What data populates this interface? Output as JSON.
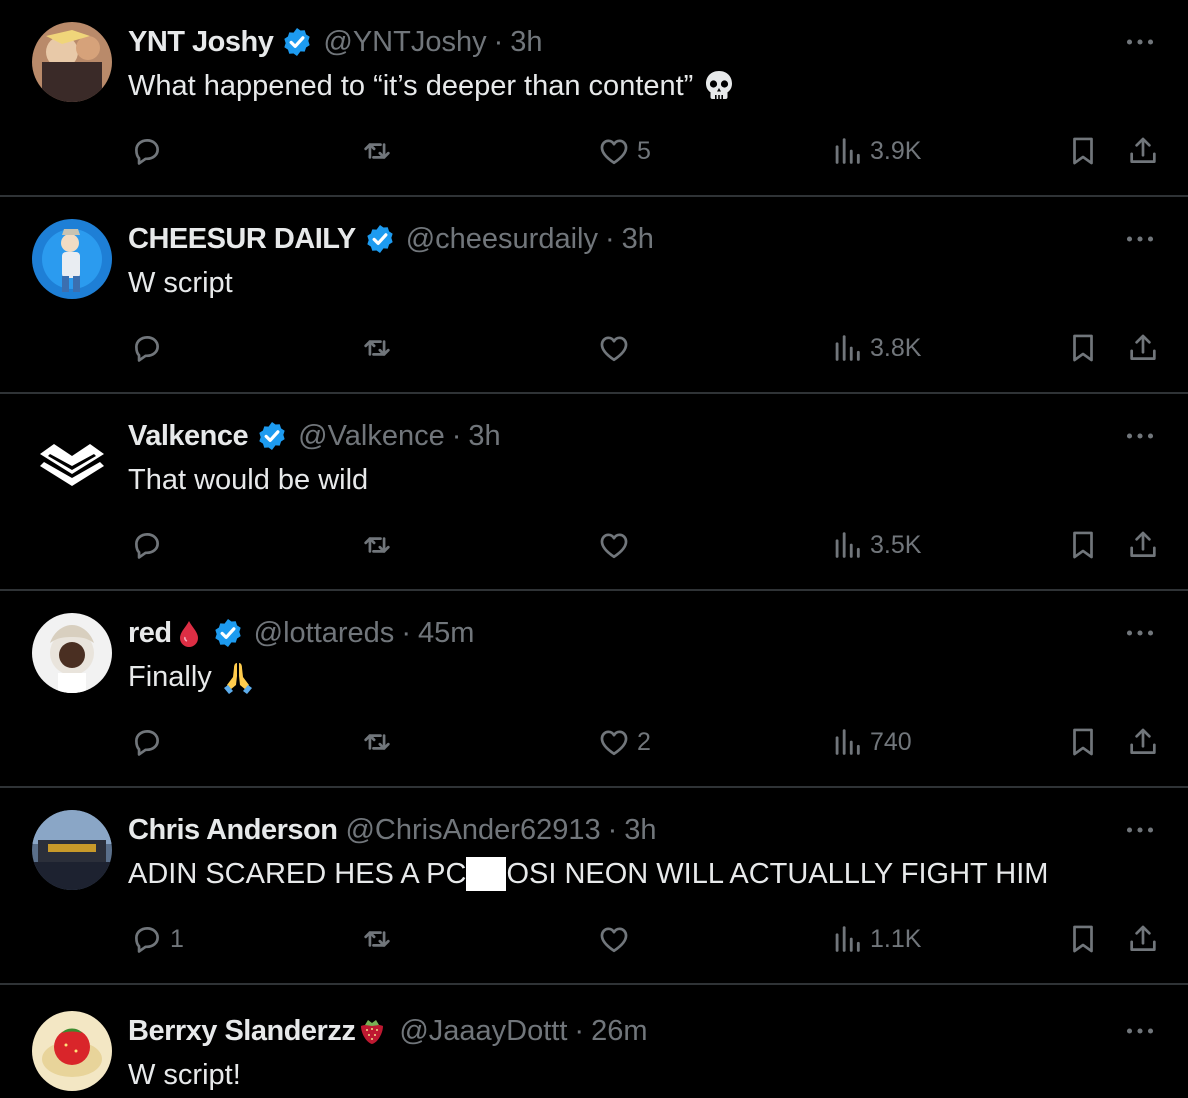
{
  "colors": {
    "background": "#000000",
    "text_primary": "#e7e9ea",
    "text_secondary": "#71767b",
    "divider": "#2f3336",
    "verified_badge": "#1d9bf0"
  },
  "icons": {
    "reply": "reply-icon",
    "retweet": "retweet-icon",
    "like": "heart-icon",
    "views": "views-icon",
    "bookmark": "bookmark-icon",
    "share": "share-icon",
    "more": "more-icon",
    "verified": "verified-badge-icon"
  },
  "tweets": [
    {
      "name": "YNT Joshy",
      "verified": true,
      "handle": "@YNTJoshy",
      "separator": "·",
      "time": "3h",
      "text": "What happened to “it’s deeper than content”",
      "text_emoji": "skull",
      "replies": "",
      "retweets": "",
      "likes": "5",
      "views": "3.9K"
    },
    {
      "name": "CHEESUR DAILY",
      "verified": true,
      "handle": "@cheesurdaily",
      "separator": "·",
      "time": "3h",
      "text": "W script",
      "replies": "",
      "retweets": "",
      "likes": "",
      "views": "3.8K"
    },
    {
      "name": "Valkence",
      "verified": true,
      "handle": "@Valkence",
      "separator": "·",
      "time": "3h",
      "text": "That would be wild",
      "replies": "",
      "retweets": "",
      "likes": "",
      "views": "3.5K"
    },
    {
      "name": "red",
      "name_emoji": "drop-of-blood",
      "verified": true,
      "handle": "@lottareds",
      "separator": "·",
      "time": "45m",
      "text": "Finally",
      "text_emoji": "folded-hands",
      "replies": "",
      "retweets": "",
      "likes": "2",
      "views": "740"
    },
    {
      "name": "Chris Anderson",
      "verified": false,
      "handle": "@ChrisAnder62913",
      "separator": "·",
      "time": "3h",
      "text_before_censor": "ADIN SCARED HES A PC",
      "text_after_censor": "OSI NEON WILL ACTUALLLY FIGHT HIM",
      "replies": "1",
      "retweets": "",
      "likes": "",
      "views": "1.1K"
    },
    {
      "name": "Berrxy Slanderzz",
      "name_emoji": "strawberry",
      "verified": false,
      "handle": "@JaaayDottt",
      "separator": "·",
      "time": "26m",
      "text": "W script!"
    }
  ]
}
